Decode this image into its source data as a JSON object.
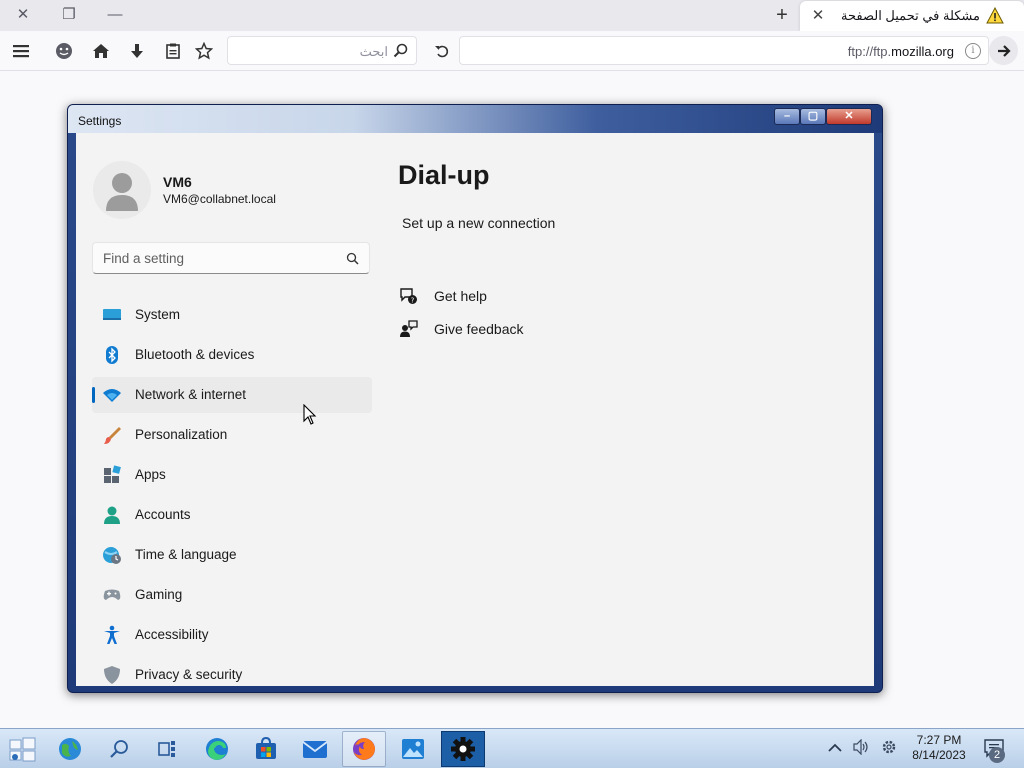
{
  "browser": {
    "tab": {
      "title": "مشكلة في تحميل الصفحة"
    },
    "search": {
      "placeholder": "ابحث"
    },
    "url": {
      "scheme": "ftp://ftp.",
      "domain": "mozilla.org"
    }
  },
  "window": {
    "title": "Settings"
  },
  "user": {
    "name": "VM6",
    "email": "VM6@collabnet.local"
  },
  "search_setting": {
    "placeholder": "Find a setting"
  },
  "nav": [
    {
      "label": "System",
      "icon": "system-icon"
    },
    {
      "label": "Bluetooth & devices",
      "icon": "bluetooth-icon"
    },
    {
      "label": "Network & internet",
      "icon": "wifi-icon",
      "active": true
    },
    {
      "label": "Personalization",
      "icon": "brush-icon"
    },
    {
      "label": "Apps",
      "icon": "apps-icon"
    },
    {
      "label": "Accounts",
      "icon": "accounts-icon"
    },
    {
      "label": "Time & language",
      "icon": "globe-clock-icon"
    },
    {
      "label": "Gaming",
      "icon": "gamepad-icon"
    },
    {
      "label": "Accessibility",
      "icon": "accessibility-icon"
    },
    {
      "label": "Privacy & security",
      "icon": "shield-icon"
    }
  ],
  "page": {
    "title": "Dial-up",
    "setup_link": "Set up a new connection",
    "get_help": "Get help",
    "give_feedback": "Give feedback"
  },
  "taskbar": {
    "time": "7:27 PM",
    "date": "8/14/2023",
    "notifications": "2"
  },
  "colors": {
    "accent": "#0067c0",
    "window_frame": "#1e3a78",
    "taskbar": "#c8dcf0"
  }
}
